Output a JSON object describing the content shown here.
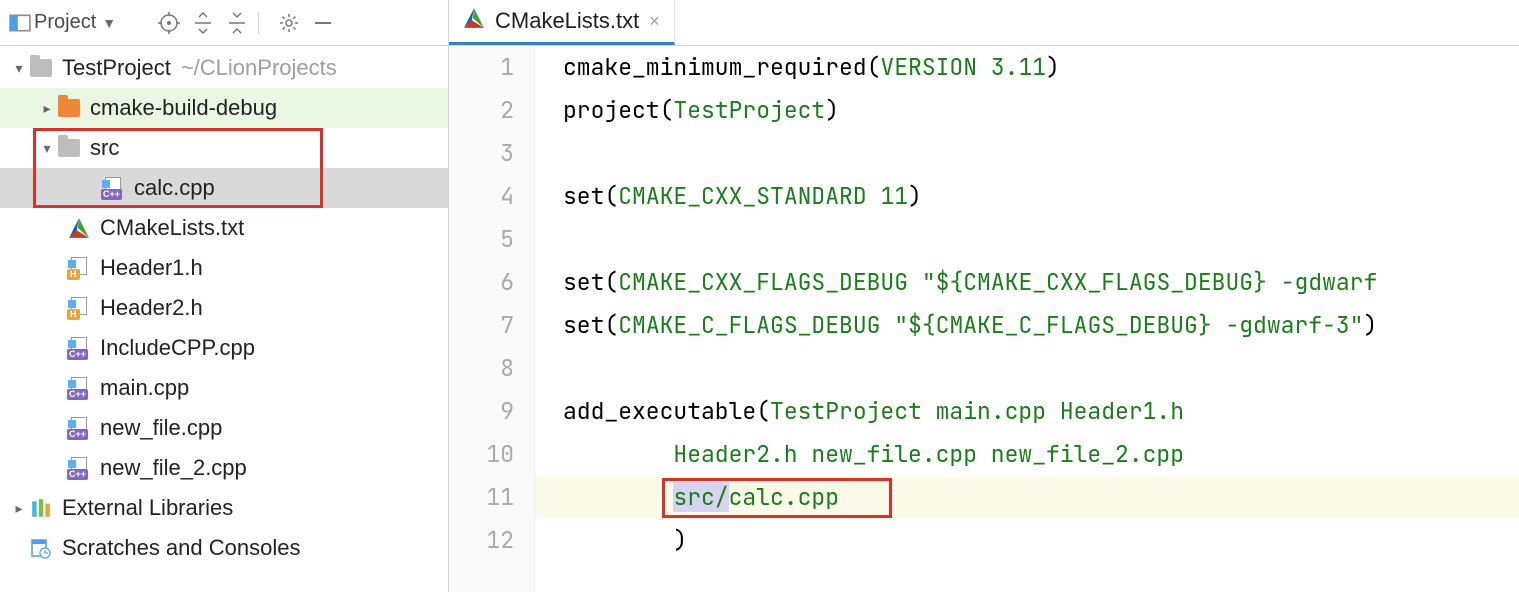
{
  "sidebar": {
    "toolwindow_label": "Project",
    "project_root": {
      "name": "TestProject",
      "path_hint": "~/CLionProjects"
    },
    "items": {
      "cmake_build_debug": "cmake-build-debug",
      "src": "src",
      "calc": "calc.cpp",
      "cmakelists": "CMakeLists.txt",
      "header1": "Header1.h",
      "header2": "Header2.h",
      "includecpp": "IncludeCPP.cpp",
      "main": "main.cpp",
      "new_file": "new_file.cpp",
      "new_file_2": "new_file_2.cpp",
      "external_libs": "External Libraries",
      "scratches": "Scratches and Consoles"
    }
  },
  "editor": {
    "tab_label": "CMakeLists.txt",
    "lines_numbers": [
      "1",
      "2",
      "3",
      "4",
      "5",
      "6",
      "7",
      "8",
      "9",
      "10",
      "11",
      "12"
    ],
    "code": {
      "l1_fn": "cmake_minimum_required",
      "l1_arg1": "VERSION",
      "l1_arg2": "3.11",
      "l2_fn": "project",
      "l2_arg": "TestProject",
      "l4_fn": "set",
      "l4_arg1": "CMAKE_CXX_STANDARD",
      "l4_arg2": "11",
      "l6_fn": "set",
      "l6_arg1": "CMAKE_CXX_FLAGS_DEBUG",
      "l6_str1": "\"${",
      "l6_str2": "CMAKE_CXX_FLAGS_DEBUG",
      "l6_str3": "} -gdwarf",
      "l7_fn": "set",
      "l7_arg1": "CMAKE_C_FLAGS_DEBUG",
      "l7_str1": "\"${",
      "l7_str2": "CMAKE_C_FLAGS_DEBUG",
      "l7_str3": "} -gdwarf-3\"",
      "l9_fn": "add_executable",
      "l9_args": "TestProject main.cpp Header1.h",
      "l10_args": "Header2.h new_file.cpp new_file_2.cpp",
      "l11_sel": "src/",
      "l11_rest": "calc.cpp",
      "l12_close": ")"
    }
  }
}
